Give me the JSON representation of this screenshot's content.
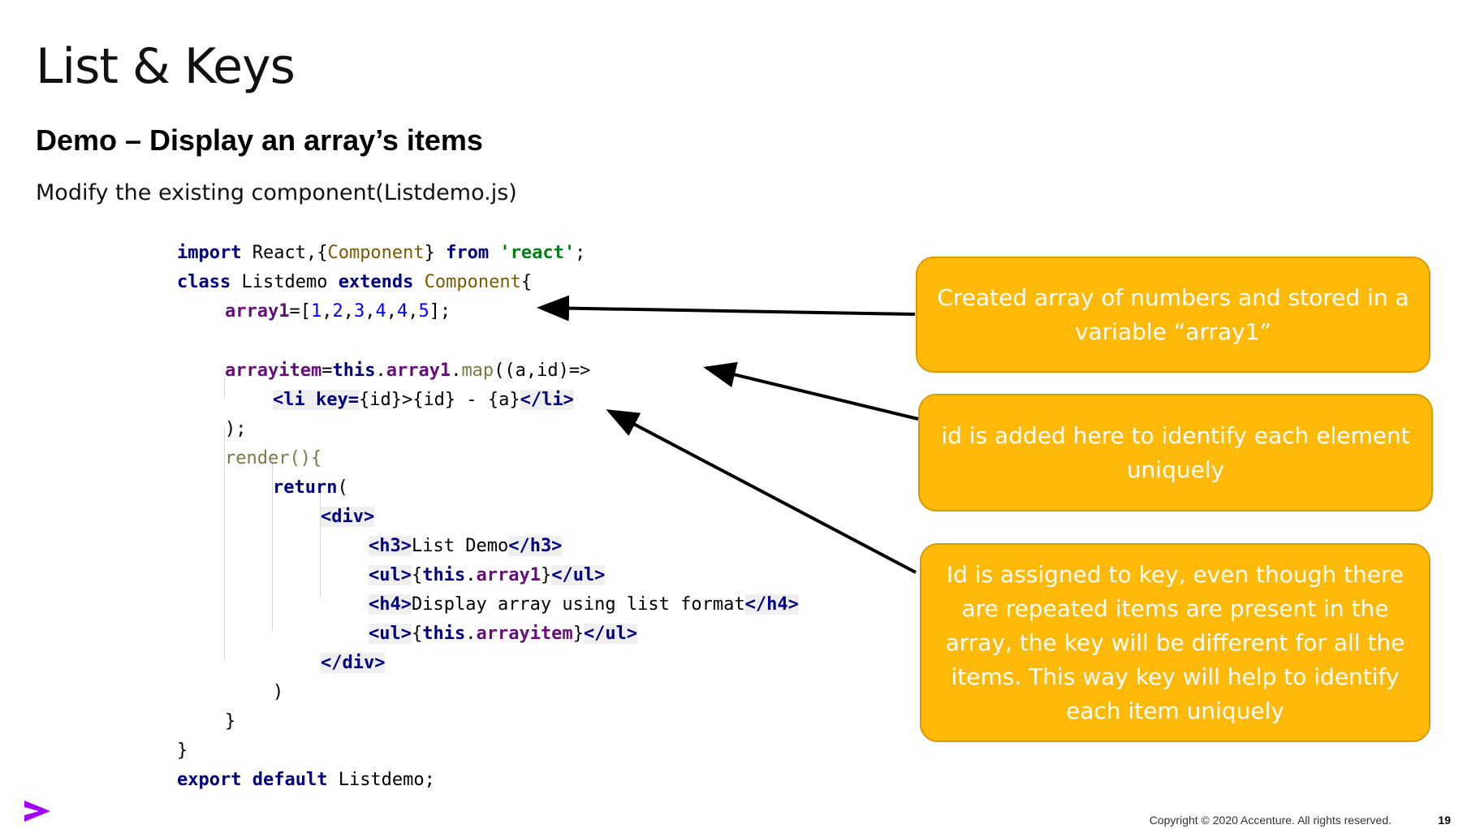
{
  "slide": {
    "title": "List & Keys",
    "subtitle": "Demo – Display an array’s items",
    "description": "Modify the existing component(Listdemo.js)",
    "footer": "Copyright © 2020 Accenture. All rights reserved.",
    "page_number": "19"
  },
  "code": {
    "l1": [
      "import",
      " React,{",
      "Component",
      "} ",
      "from",
      " ",
      "'react'",
      ";"
    ],
    "l2": [
      "class",
      " Listdemo ",
      "extends",
      " ",
      "Component",
      "{"
    ],
    "l3": [
      "array1",
      "=[",
      "1",
      ",",
      "2",
      ",",
      "3",
      ",",
      "4",
      ",",
      "4",
      ",",
      "5",
      "];"
    ],
    "l5": [
      "arrayitem",
      "=",
      "this",
      ".",
      "array1",
      ".",
      "map",
      "((a,id)=>"
    ],
    "l6": [
      "<li ",
      "key=",
      "{id}>{id} - {a}",
      "</li>"
    ],
    "l7": ");",
    "l8": "render(){",
    "l9": [
      "return",
      "("
    ],
    "l10": "<div>",
    "l11": [
      "<h3>",
      "List Demo",
      "</h3>"
    ],
    "l12": [
      "<ul>",
      "{",
      "this",
      ".",
      "array1",
      "}",
      "</ul>"
    ],
    "l13": [
      "<h4>",
      "Display array using list format",
      "</h4>"
    ],
    "l14": [
      "<ul>",
      "{",
      "this",
      ".",
      "arrayitem",
      "}",
      "</ul>"
    ],
    "l15": "</div>",
    "l16": ")",
    "l17": "}",
    "l18": "}",
    "l19": [
      "export",
      " ",
      "default",
      " Listdemo;"
    ]
  },
  "callouts": [
    "Created array of numbers and stored in a variable “array1”",
    "id is added here to identify each element uniquely",
    "Id is assigned to key, even though there are repeated items are present in the array, the key will be different for all the items. This way key will help to identify each item uniquely"
  ],
  "colors": {
    "callout": "#ffb909",
    "brand": "#a100ff"
  },
  "icons": {
    "logo": "accenture-chevron-logo"
  }
}
